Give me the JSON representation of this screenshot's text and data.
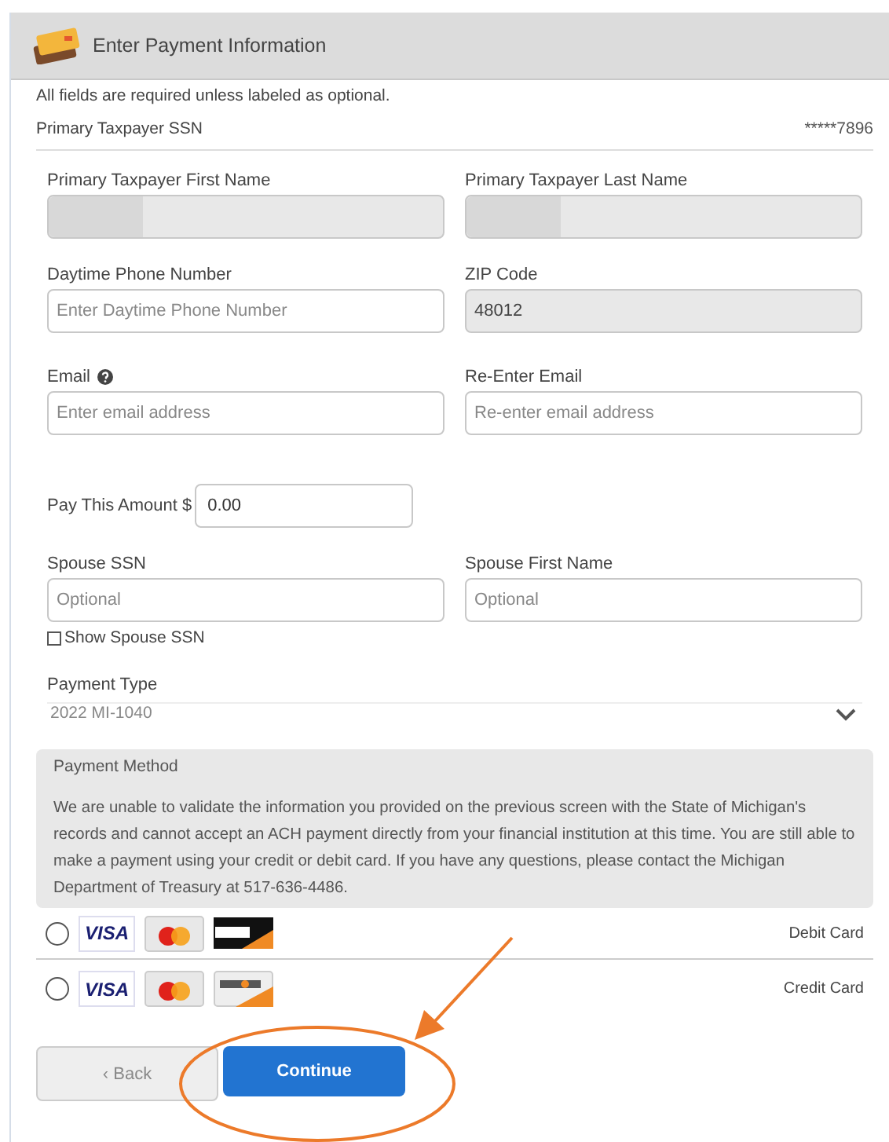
{
  "header": {
    "title": "Enter Payment Information"
  },
  "note": "All fields are required unless labeled as optional.",
  "ssn": {
    "label": "Primary Taxpayer SSN",
    "value": "*****7896"
  },
  "field_rows": [
    {
      "fields": [
        {
          "label": "Primary Taxpayer First Name",
          "disabled": true,
          "redacted": true
        },
        {
          "label": "Primary Taxpayer Last Name",
          "disabled": true,
          "redacted": true
        }
      ]
    },
    {
      "fields": [
        {
          "label": "Daytime Phone Number",
          "placeholder": "Enter Daytime Phone Number",
          "disabled": false
        },
        {
          "label": "ZIP Code",
          "value": "48012",
          "disabled": true
        }
      ]
    },
    {
      "fields": [
        {
          "label": "Email",
          "help": true,
          "placeholder": "Enter email address",
          "disabled": false
        },
        {
          "label": "Re-Enter Email",
          "placeholder": "Re-enter email address",
          "disabled": false
        }
      ]
    }
  ],
  "amount": {
    "label": "Pay This Amount $",
    "value": "0.00"
  },
  "spouse_row": {
    "fields": [
      {
        "label": "Spouse SSN",
        "placeholder": "Optional",
        "disabled": false
      },
      {
        "label": "Spouse First Name",
        "placeholder": "Optional",
        "disabled": false
      }
    ]
  },
  "show_spouse_ssn": {
    "label": "Show Spouse SSN",
    "checked": false
  },
  "payment_type": {
    "label": "Payment Type",
    "value": "2022 MI-1040"
  },
  "payment_method": {
    "title": "Payment Method",
    "message": "We are unable to validate the information you provided on the previous screen with the State of Michigan's records and cannot accept an ACH payment directly from your financial institution at this time. You are still able to make a payment using your credit or debit card. If you have any questions, please contact the Michigan Department of Treasury at 517-636-4486."
  },
  "card_options": [
    {
      "visa": "VISA",
      "label": "Debit Card",
      "selected": false,
      "kind": "debit"
    },
    {
      "visa": "VISA",
      "label": "Credit Card",
      "selected": false,
      "kind": "credit"
    }
  ],
  "buttons": {
    "back": "‹ Back",
    "continue": "Continue"
  }
}
